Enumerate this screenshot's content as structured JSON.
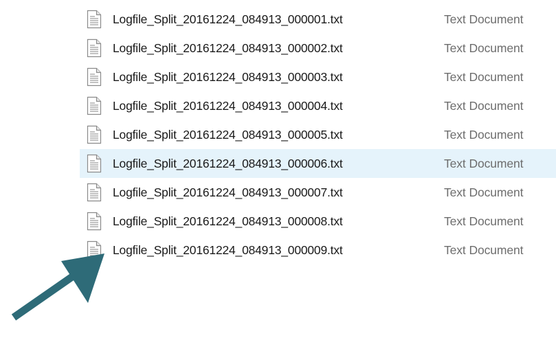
{
  "files": [
    {
      "name": "Logfile_Split_20161224_084913_000001.txt",
      "type": "Text Document",
      "icon": "text-document-icon",
      "hovered": false
    },
    {
      "name": "Logfile_Split_20161224_084913_000002.txt",
      "type": "Text Document",
      "icon": "text-document-icon",
      "hovered": false
    },
    {
      "name": "Logfile_Split_20161224_084913_000003.txt",
      "type": "Text Document",
      "icon": "text-document-icon",
      "hovered": false
    },
    {
      "name": "Logfile_Split_20161224_084913_000004.txt",
      "type": "Text Document",
      "icon": "text-document-icon",
      "hovered": false
    },
    {
      "name": "Logfile_Split_20161224_084913_000005.txt",
      "type": "Text Document",
      "icon": "text-document-icon",
      "hovered": false
    },
    {
      "name": "Logfile_Split_20161224_084913_000006.txt",
      "type": "Text Document",
      "icon": "text-document-icon",
      "hovered": true
    },
    {
      "name": "Logfile_Split_20161224_084913_000007.txt",
      "type": "Text Document",
      "icon": "text-document-icon",
      "hovered": false
    },
    {
      "name": "Logfile_Split_20161224_084913_000008.txt",
      "type": "Text Document",
      "icon": "text-document-icon",
      "hovered": false
    },
    {
      "name": "Logfile_Split_20161224_084913_000009.txt",
      "type": "Text Document",
      "icon": "text-document-icon",
      "hovered": false
    }
  ],
  "colors": {
    "hover_background": "#e5f3fb",
    "name_text": "#1a1a1a",
    "type_text": "#6d6d6d",
    "annotation_arrow": "#2e6b78"
  },
  "annotation": {
    "icon": "arrow-pointer-icon"
  }
}
